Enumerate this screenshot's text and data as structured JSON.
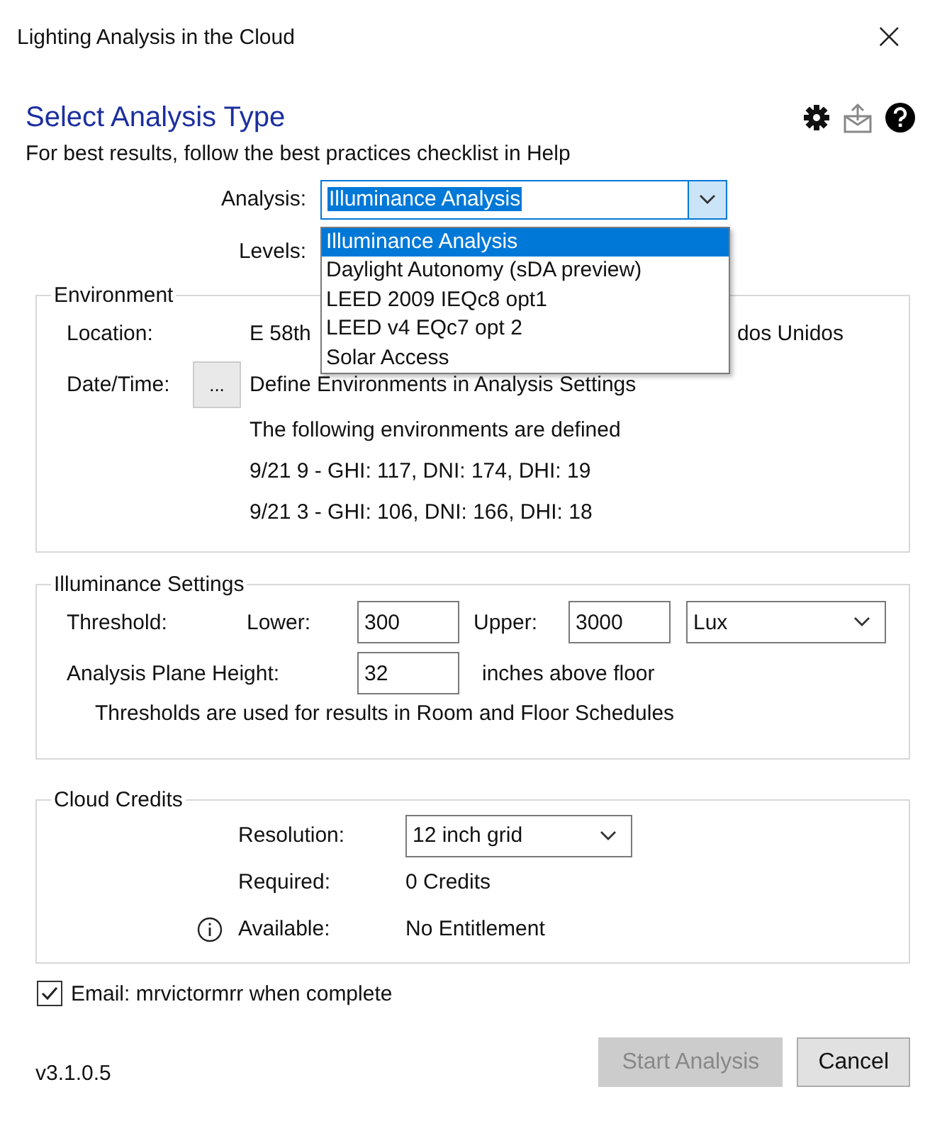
{
  "window": {
    "title": "Lighting Analysis in the Cloud",
    "close": "×"
  },
  "heading": "Select Analysis Type",
  "hint": "For best results, follow the best practices checklist in Help",
  "analysis": {
    "label": "Analysis:",
    "value": "Illuminance Analysis",
    "expanded": true,
    "options": [
      {
        "label": "Illuminance Analysis",
        "selected": true
      },
      {
        "label": "Daylight Autonomy (sDA preview)",
        "selected": false
      },
      {
        "label": "LEED 2009 IEQc8 opt1",
        "selected": false
      },
      {
        "label": "LEED v4 EQc7 opt 2",
        "selected": false
      },
      {
        "label": "Solar Access",
        "selected": false
      }
    ]
  },
  "levels": {
    "label": "Levels:"
  },
  "environment": {
    "title": "Environment",
    "location_label": "Location:",
    "location_start": "E 58th",
    "location_end": "dos Unidos",
    "datetime_label": "Date/Time:",
    "datetime_button": "...",
    "datetime_text": "Define Environments in Analysis Settings",
    "lines": [
      "The following environments are defined",
      "9/21 9 - GHI: 117, DNI: 174, DHI: 19",
      "9/21 3 - GHI: 106, DNI: 166, DHI: 18"
    ]
  },
  "illuminance": {
    "title": "Illuminance Settings",
    "threshold_label": "Threshold:",
    "lower_label": "Lower:",
    "lower": "300",
    "upper_label": "Upper:",
    "upper": "3000",
    "unit": "Lux",
    "plane_label": "Analysis Plane Height:",
    "plane": "32",
    "plane_unit": "inches above floor",
    "note": "Thresholds are used for results in Room and Floor Schedules"
  },
  "credits": {
    "title": "Cloud Credits",
    "resolution_label": "Resolution:",
    "resolution": "12 inch grid",
    "required_label": "Required:",
    "required": "0 Credits",
    "available_label": "Available:",
    "available": "No Entitlement"
  },
  "email": {
    "label": "Email: mrvictormrr when complete",
    "checked": true
  },
  "version": "v3.1.0.5",
  "buttons": [
    {
      "label": "Start Analysis",
      "disabled": true
    },
    {
      "label": "Cancel",
      "disabled": false
    }
  ]
}
